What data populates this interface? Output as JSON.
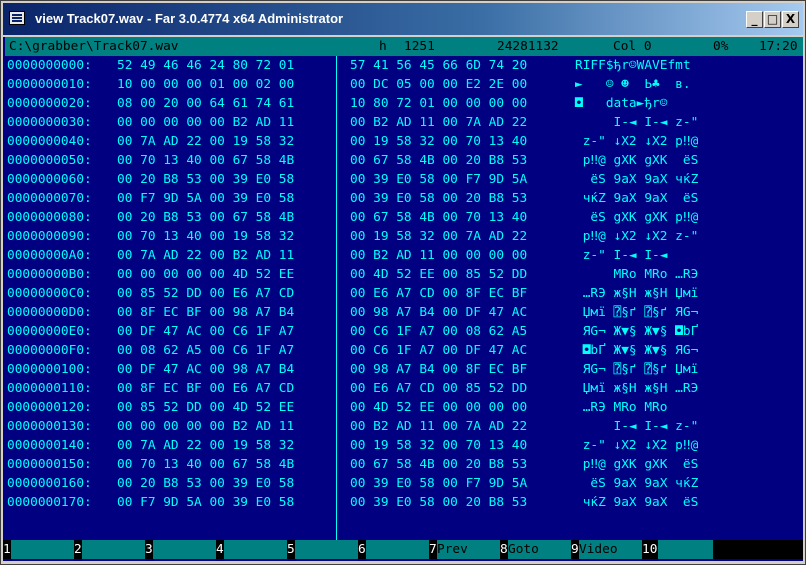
{
  "window": {
    "title": "view Track07.wav - Far 3.0.4774 x64 Administrator",
    "buttons": {
      "minimize": "_",
      "maximize": "□",
      "close": "X"
    }
  },
  "status": {
    "path": "C:\\grabber\\Track07.wav",
    "mode": "h",
    "codepage": "1251",
    "size": "24281132",
    "col": "Col 0",
    "percent": "0%",
    "time": "17:20"
  },
  "hex_rows": [
    {
      "offset": "0000000000:",
      "hex1": "52 49 46 46 24 80 72 01",
      "hex2": "57 41 56 45 66 6D 74 20",
      "text": "RIFF$ђr☺WAVEfmt "
    },
    {
      "offset": "0000000010:",
      "hex1": "10 00 00 00 01 00 02 00",
      "hex2": "00 DC 05 00 00 E2 2E 00",
      "text": "►   ☺ ☻  Ь♣  в. "
    },
    {
      "offset": "0000000020:",
      "hex1": "08 00 20 00 64 61 74 61",
      "hex2": "10 80 72 01 00 00 00 00",
      "text": "◘   data►ђr☺    "
    },
    {
      "offset": "0000000030:",
      "hex1": "00 00 00 00 00 B2 AD 11",
      "hex2": "00 B2 AD 11 00 7A AD 22",
      "text": "     І-◄ І-◄ z-\""
    },
    {
      "offset": "0000000040:",
      "hex1": "00 7A AD 22 00 19 58 32",
      "hex2": "00 19 58 32 00 70 13 40",
      "text": " z-\" ↓X2 ↓X2 p‼@"
    },
    {
      "offset": "0000000050:",
      "hex1": "00 70 13 40 00 67 58 4B",
      "hex2": "00 67 58 4B 00 20 B8 53",
      "text": " p‼@ gXK gXK  ёS"
    },
    {
      "offset": "0000000060:",
      "hex1": "00 20 B8 53 00 39 E0 58",
      "hex2": "00 39 E0 58 00 F7 9D 5A",
      "text": "  ёS 9аX 9аX чќZ"
    },
    {
      "offset": "0000000070:",
      "hex1": "00 F7 9D 5A 00 39 E0 58",
      "hex2": "00 39 E0 58 00 20 B8 53",
      "text": " чќZ 9аX 9аX  ёS"
    },
    {
      "offset": "0000000080:",
      "hex1": "00 20 B8 53 00 67 58 4B",
      "hex2": "00 67 58 4B 00 70 13 40",
      "text": "  ёS gXK gXK p‼@"
    },
    {
      "offset": "0000000090:",
      "hex1": "00 70 13 40 00 19 58 32",
      "hex2": "00 19 58 32 00 7A AD 22",
      "text": " p‼@ ↓X2 ↓X2 z-\""
    },
    {
      "offset": "00000000A0:",
      "hex1": "00 7A AD 22 00 B2 AD 11",
      "hex2": "00 B2 AD 11 00 00 00 00",
      "text": " z-\" І-◄ І-◄    "
    },
    {
      "offset": "00000000B0:",
      "hex1": "00 00 00 00 00 4D 52 EE",
      "hex2": "00 4D 52 EE 00 85 52 DD",
      "text": "     MRo MRo …RЭ"
    },
    {
      "offset": "00000000C0:",
      "hex1": "00 85 52 DD 00 E6 A7 CD",
      "hex2": "00 E6 A7 CD 00 8F EC BF",
      "text": " …RЭ ж§Н ж§Н Џмї"
    },
    {
      "offset": "00000000D0:",
      "hex1": "00 8F EC BF 00 98 A7 B4",
      "hex2": "00 98 A7 B4 00 DF 47 AC",
      "text": " Џмї ⍰§ґ ⍰§ґ ЯG¬"
    },
    {
      "offset": "00000000E0:",
      "hex1": "00 DF 47 AC 00 C6 1F A7",
      "hex2": "00 C6 1F A7 00 08 62 A5",
      "text": " ЯG¬ Ж▼§ Ж▼§ ◘bҐ"
    },
    {
      "offset": "00000000F0:",
      "hex1": "00 08 62 A5 00 C6 1F A7",
      "hex2": "00 C6 1F A7 00 DF 47 AC",
      "text": " ◘bҐ Ж▼§ Ж▼§ ЯG¬"
    },
    {
      "offset": "0000000100:",
      "hex1": "00 DF 47 AC 00 98 A7 B4",
      "hex2": "00 98 A7 B4 00 8F EC BF",
      "text": " ЯG¬ ⍰§ґ ⍰§ґ Џмї"
    },
    {
      "offset": "0000000110:",
      "hex1": "00 8F EC BF 00 E6 A7 CD",
      "hex2": "00 E6 A7 CD 00 85 52 DD",
      "text": " Џмї ж§Н ж§Н …RЭ"
    },
    {
      "offset": "0000000120:",
      "hex1": "00 85 52 DD 00 4D 52 EE",
      "hex2": "00 4D 52 EE 00 00 00 00",
      "text": " …RЭ MRo MRo    "
    },
    {
      "offset": "0000000130:",
      "hex1": "00 00 00 00 00 B2 AD 11",
      "hex2": "00 B2 AD 11 00 7A AD 22",
      "text": "     І-◄ І-◄ z-\""
    },
    {
      "offset": "0000000140:",
      "hex1": "00 7A AD 22 00 19 58 32",
      "hex2": "00 19 58 32 00 70 13 40",
      "text": " z-\" ↓X2 ↓X2 p‼@"
    },
    {
      "offset": "0000000150:",
      "hex1": "00 70 13 40 00 67 58 4B",
      "hex2": "00 67 58 4B 00 20 B8 53",
      "text": " p‼@ gXK gXK  ёS"
    },
    {
      "offset": "0000000160:",
      "hex1": "00 20 B8 53 00 39 E0 58",
      "hex2": "00 39 E0 58 00 F7 9D 5A",
      "text": "  ёS 9аX 9аX чќZ"
    },
    {
      "offset": "0000000170:",
      "hex1": "00 F7 9D 5A 00 39 E0 58",
      "hex2": "00 39 E0 58 00 20 B8 53",
      "text": " чќZ 9аX 9аX  ёS"
    }
  ],
  "keybar": [
    {
      "num": "1",
      "label": ""
    },
    {
      "num": "2",
      "label": ""
    },
    {
      "num": "3",
      "label": ""
    },
    {
      "num": "4",
      "label": ""
    },
    {
      "num": "5",
      "label": ""
    },
    {
      "num": "6",
      "label": ""
    },
    {
      "num": "7",
      "label": "Prev"
    },
    {
      "num": "8",
      "label": "Goto"
    },
    {
      "num": "9",
      "label": "Video"
    },
    {
      "num": "10",
      "label": ""
    }
  ],
  "colors": {
    "background": "#000080",
    "text": "#00ffff",
    "statusbar": "#008080",
    "title_gradient_start": "#0a246a"
  }
}
